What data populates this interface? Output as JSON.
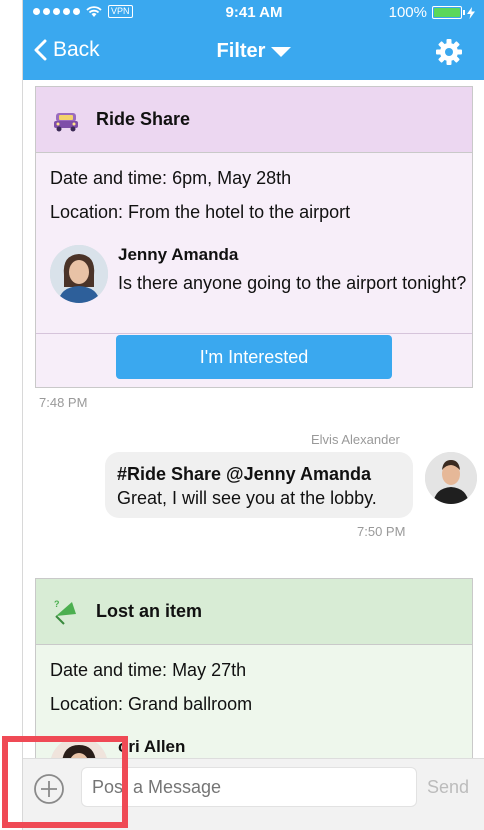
{
  "status_bar": {
    "carrier_extra": "VPN",
    "time": "9:41 AM",
    "battery": "100%"
  },
  "nav": {
    "back_label": "Back",
    "title": "Filter"
  },
  "ride_card": {
    "title": "Ride Share",
    "date_line": "Date and time: 6pm, May 28th",
    "location_line": "Location: From the hotel to the airport",
    "poster_name": "Jenny Amanda",
    "message": "Is there anyone going to the airport tonight?",
    "button_label": "I'm Interested",
    "timestamp": "7:48 PM"
  },
  "reply": {
    "sender": "Elvis Alexander",
    "line1": "#Ride Share @Jenny Amanda",
    "line2": "Great, I will see you at the lobby.",
    "timestamp": "7:50 PM"
  },
  "lost_card": {
    "title": "Lost an item",
    "date_line": "Date and time: May 27th",
    "location_line": "Location: Grand ballroom",
    "poster_name_partial": "ori Allen"
  },
  "composer": {
    "placeholder": "Post a Message",
    "send_label": "Send"
  },
  "colors": {
    "accent": "#3aa8ef",
    "highlight": "#ef4a55",
    "ride_header": "#ecd7f1",
    "lost_header": "#d8ecd5"
  }
}
